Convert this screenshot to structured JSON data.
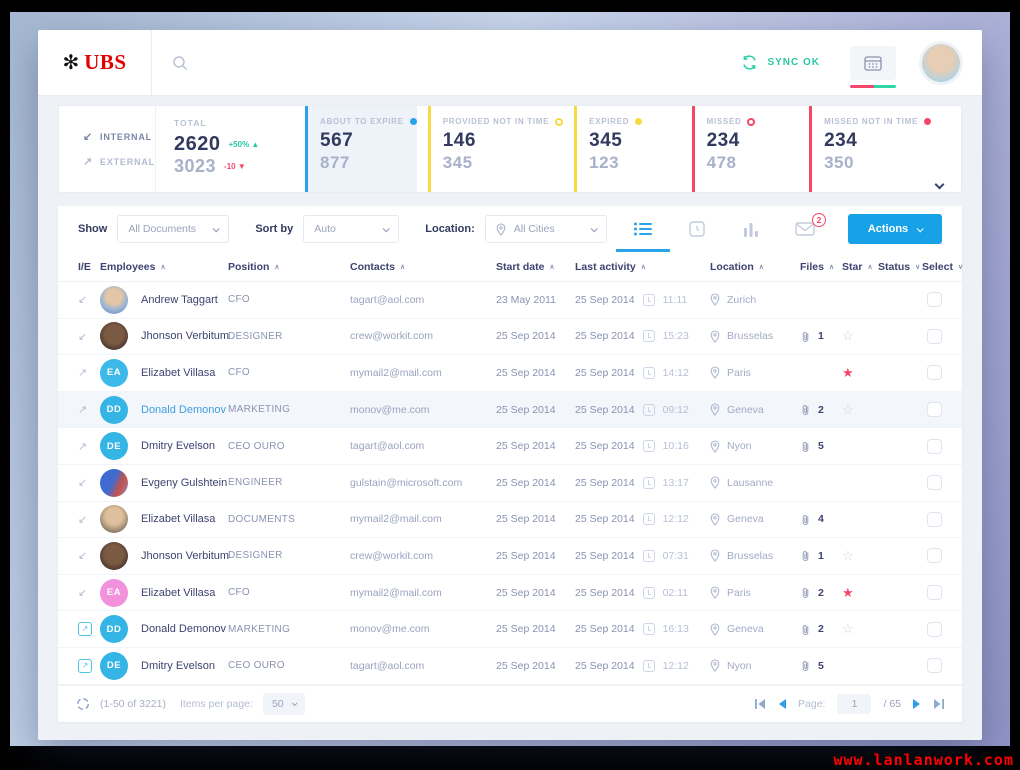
{
  "header": {
    "brand": "UBS",
    "sync_label": "SYNC OK"
  },
  "stats": {
    "internal_label": "INTERNAL",
    "external_label": "EXTERNAL",
    "total": {
      "label": "TOTAL",
      "internal": "2620",
      "internal_delta": "+50% ▲",
      "external": "3023",
      "external_delta": "-10 ▼"
    },
    "cards": [
      {
        "label": "ABOUT TO EXPIRE",
        "value1": "567",
        "value2": "877",
        "color": "#29a3e8",
        "dot": "filled",
        "highlighted": true
      },
      {
        "label": "PROVIDED NOT IN TIME",
        "value1": "146",
        "value2": "345",
        "color": "#f7d944",
        "dot": "outline",
        "highlighted": false
      },
      {
        "label": "EXPIRED",
        "value1": "345",
        "value2": "123",
        "color": "#f7d944",
        "dot": "filled",
        "highlighted": false
      },
      {
        "label": "MISSED",
        "value1": "234",
        "value2": "478",
        "color": "#f5476a",
        "dot": "outline",
        "highlighted": false
      },
      {
        "label": "MISSED NOT IN TIME",
        "value1": "234",
        "value2": "350",
        "color": "#f5476a",
        "dot": "filled",
        "highlighted": false
      }
    ]
  },
  "filters": {
    "show_label": "Show",
    "show_value": "All Documents",
    "sort_label": "Sort by",
    "sort_value": "Auto",
    "location_label": "Location:",
    "location_value": "All Cities",
    "mail_badge": "2",
    "actions_label": "Actions"
  },
  "icons": {
    "internal_arrow": "↙",
    "external_arrow": "↗",
    "external_link_arrow": "↗",
    "star_filled": "★",
    "star_outline": "☆"
  },
  "status_colors": {
    "blue": "#29a3e8",
    "green": "#2ee066",
    "yellow": "#f7d944",
    "red": "#f5476a"
  },
  "table": {
    "columns": [
      {
        "label": "I/E",
        "sort": ""
      },
      {
        "label": "Employees",
        "sort": "up"
      },
      {
        "label": "Position",
        "sort": "up"
      },
      {
        "label": "Contacts",
        "sort": "up"
      },
      {
        "label": "Start date",
        "sort": "up"
      },
      {
        "label": "Last activity",
        "sort": "up"
      },
      {
        "label": "Location",
        "sort": "up"
      },
      {
        "label": "Files",
        "sort": "up"
      },
      {
        "label": "Star",
        "sort": "up"
      },
      {
        "label": "Status",
        "sort": "down"
      },
      {
        "label": "Select",
        "sort": "down"
      }
    ],
    "rows": [
      {
        "ie": "internal",
        "avatar": {
          "type": "photo",
          "variant": "p1"
        },
        "name": "Andrew Taggart",
        "name_blue": false,
        "position": "CFO",
        "contact": "tagart@aol.com",
        "start_date": "23 May 2011",
        "last_date": "25 Sep 2014",
        "last_time": "11:11",
        "location": "Zurich",
        "files": "",
        "star": "none",
        "status": "blue",
        "highlight": false
      },
      {
        "ie": "internal",
        "avatar": {
          "type": "photo",
          "variant": "p2"
        },
        "name": "Jhonson Verbitum",
        "name_blue": false,
        "position": "DESIGNER",
        "contact": "crew@workit.com",
        "start_date": "25 Sep 2014",
        "last_date": "25 Sep 2014",
        "last_time": "15:23",
        "location": "Brusselas",
        "files": "1",
        "star": "outline",
        "status": "blue",
        "highlight": false
      },
      {
        "ie": "external",
        "avatar": {
          "type": "initials",
          "text": "EA",
          "color": "#3cb9e8"
        },
        "name": "Elizabet Villasa",
        "name_blue": false,
        "position": "CFO",
        "contact": "mymail2@mail.com",
        "start_date": "25 Sep 2014",
        "last_date": "25 Sep 2014",
        "last_time": "14:12",
        "location": "Paris",
        "files": "",
        "star": "filled",
        "status": "blue",
        "highlight": false
      },
      {
        "ie": "external",
        "avatar": {
          "type": "initials",
          "text": "DD",
          "color": "#35b5e5"
        },
        "name": "Donald Demonov",
        "name_blue": true,
        "position": "MARKETING",
        "contact": "monov@me.com",
        "start_date": "25 Sep 2014",
        "last_date": "25 Sep 2014",
        "last_time": "09:12",
        "location": "Geneva",
        "files": "2",
        "star": "outline",
        "status": "blue",
        "highlight": true
      },
      {
        "ie": "external",
        "avatar": {
          "type": "initials",
          "text": "DE",
          "color": "#35b5e5"
        },
        "name": "Dmitry Evelson",
        "name_blue": false,
        "position": "CEO OURO",
        "contact": "tagart@aol.com",
        "start_date": "25 Sep 2014",
        "last_date": "25 Sep 2014",
        "last_time": "10:16",
        "location": "Nyon",
        "files": "5",
        "star": "none",
        "status": "green",
        "highlight": false
      },
      {
        "ie": "internal",
        "avatar": {
          "type": "photo",
          "variant": "p3"
        },
        "name": "Evgeny Gulshtein",
        "name_blue": false,
        "position": "ENGINEER",
        "contact": "gulstain@microsoft.com",
        "start_date": "25 Sep 2014",
        "last_date": "25 Sep 2014",
        "last_time": "13:17",
        "location": "Lausanne",
        "files": "",
        "star": "none",
        "status": "yellow",
        "highlight": false
      },
      {
        "ie": "internal",
        "avatar": {
          "type": "photo",
          "variant": "p4"
        },
        "name": "Elizabet Villasa",
        "name_blue": false,
        "position": "DOCUMENTS",
        "contact": "mymail2@mail.com",
        "start_date": "25 Sep 2014",
        "last_date": "25 Sep 2014",
        "last_time": "12:12",
        "location": "Geneva",
        "files": "4",
        "star": "none",
        "status": "red",
        "highlight": false
      },
      {
        "ie": "internal",
        "avatar": {
          "type": "photo",
          "variant": "p2"
        },
        "name": "Jhonson Verbitum",
        "name_blue": false,
        "position": "DESIGNER",
        "contact": "crew@workit.com",
        "start_date": "25 Sep 2014",
        "last_date": "25 Sep 2014",
        "last_time": "07:31",
        "location": "Brusselas",
        "files": "1",
        "star": "outline",
        "status": "blue",
        "highlight": false
      },
      {
        "ie": "internal",
        "avatar": {
          "type": "initials",
          "text": "EA",
          "color": "#f292dd"
        },
        "name": "Elizabet Villasa",
        "name_blue": false,
        "position": "CFO",
        "contact": "mymail2@mail.com",
        "start_date": "25 Sep 2014",
        "last_date": "25 Sep 2014",
        "last_time": "02:11",
        "location": "Paris",
        "files": "2",
        "star": "filled",
        "status": "none",
        "highlight": false
      },
      {
        "ie": "link",
        "avatar": {
          "type": "initials",
          "text": "DD",
          "color": "#35b5e5"
        },
        "name": "Donald Demonov",
        "name_blue": false,
        "position": "MARKETING",
        "contact": "monov@me.com",
        "start_date": "25 Sep 2014",
        "last_date": "25 Sep 2014",
        "last_time": "16:13",
        "location": "Geneva",
        "files": "2",
        "star": "outline",
        "status": "blue",
        "highlight": false
      },
      {
        "ie": "link",
        "avatar": {
          "type": "initials",
          "text": "DE",
          "color": "#35b5e5"
        },
        "name": "Dmitry Evelson",
        "name_blue": false,
        "position": "CEO OURO",
        "contact": "tagart@aol.com",
        "start_date": "25 Sep 2014",
        "last_date": "25 Sep 2014",
        "last_time": "12:12",
        "location": "Nyon",
        "files": "5",
        "star": "none",
        "status": "green",
        "highlight": false
      }
    ]
  },
  "footer": {
    "range": "(1-50 of 3221)",
    "items_per_page_label": "Items per page:",
    "items_per_page": "50",
    "page_label": "Page:",
    "page": "1",
    "total_pages": "/ 65"
  },
  "watermark": "www.lanlanwork.com"
}
